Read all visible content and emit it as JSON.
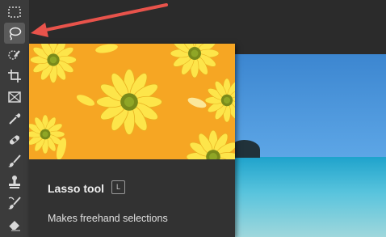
{
  "tooltip": {
    "title": "Lasso tool",
    "shortcut": "L",
    "description": "Makes freehand selections"
  },
  "toolbar": {
    "tools": [
      "rectangular-marquee-icon",
      "lasso-icon",
      "quick-selection-icon",
      "crop-icon",
      "frame-icon",
      "eyedropper-icon",
      "spot-healing-icon",
      "brush-icon",
      "clone-stamp-icon",
      "history-brush-icon",
      "eraser-icon"
    ],
    "active_tool": "lasso-icon"
  },
  "colors": {
    "toolbar_bg": "#3b3b3b",
    "tooltip_bg": "#323232",
    "preview_bg": "#f6a623",
    "annotation_arrow": "#e8534b"
  }
}
